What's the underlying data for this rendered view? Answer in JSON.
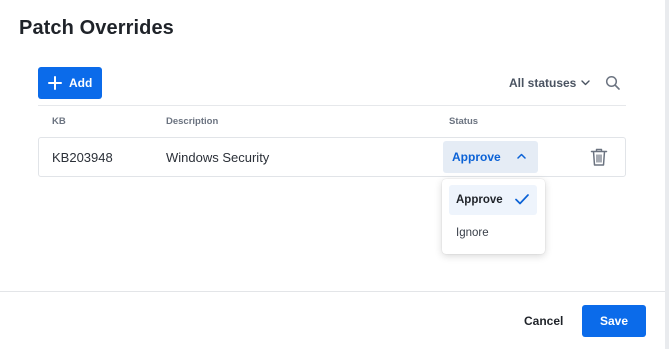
{
  "dialog": {
    "title": "Patch Overrides"
  },
  "toolbar": {
    "add_label": "Add",
    "filter_label": "All statuses"
  },
  "table": {
    "columns": [
      "KB",
      "Description",
      "Status"
    ],
    "rows": [
      {
        "kb": "KB203948",
        "description": "Windows Security",
        "status": "Approve"
      }
    ]
  },
  "status_dropdown": {
    "options": [
      "Approve",
      "Ignore"
    ],
    "selected": "Approve"
  },
  "footer": {
    "cancel_label": "Cancel",
    "save_label": "Save"
  },
  "colors": {
    "primary": "#0b6bea",
    "select_bg": "#e5ecf5",
    "selected_option_bg": "#eef4fc"
  }
}
